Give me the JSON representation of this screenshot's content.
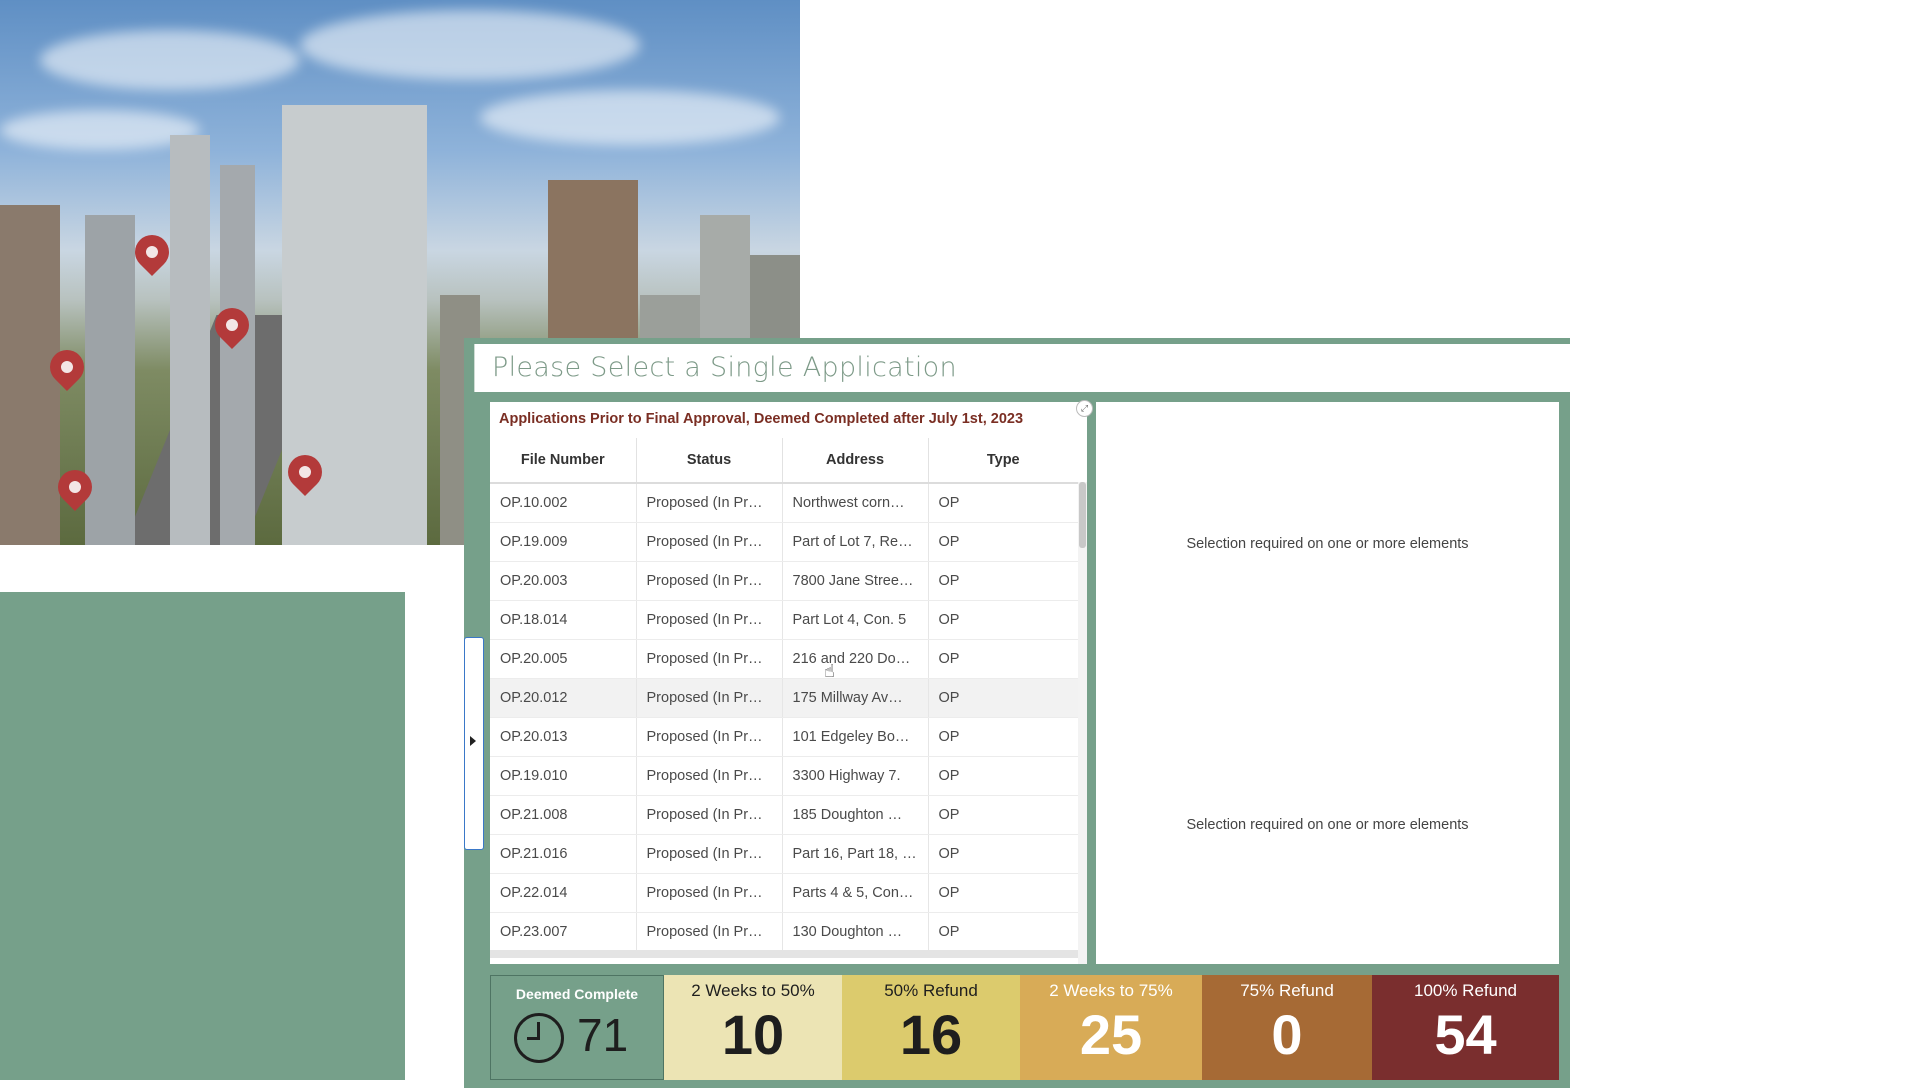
{
  "header": {
    "title": "Please Select a Single Application"
  },
  "table": {
    "title": "Applications Prior to Final Approval, Deemed Completed after July 1st, 2023",
    "columns": [
      "File Number",
      "Status",
      "Address",
      "Type"
    ],
    "rows": [
      {
        "file": "OP.10.002",
        "status": "Proposed (In Pr…",
        "address": "Northwest corn…",
        "type": "OP"
      },
      {
        "file": "OP.19.009",
        "status": "Proposed (In Pr…",
        "address": "Part of Lot 7, Re…",
        "type": "OP"
      },
      {
        "file": "OP.20.003",
        "status": "Proposed (In Pr…",
        "address": "7800 Jane Stree…",
        "type": "OP"
      },
      {
        "file": "OP.18.014",
        "status": "Proposed (In Pr…",
        "address": "Part Lot 4, Con. 5",
        "type": "OP"
      },
      {
        "file": "OP.20.005",
        "status": "Proposed (In Pr…",
        "address": "216 and 220 Do…",
        "type": "OP"
      },
      {
        "file": "OP.20.012",
        "status": "Proposed (In Pr…",
        "address": "175 Millway Av…",
        "type": "OP"
      },
      {
        "file": "OP.20.013",
        "status": "Proposed (In Pr…",
        "address": "101 Edgeley Bo…",
        "type": "OP"
      },
      {
        "file": "OP.19.010",
        "status": "Proposed (In Pr…",
        "address": "3300 Highway 7.",
        "type": "OP"
      },
      {
        "file": "OP.21.008",
        "status": "Proposed (In Pr…",
        "address": "185 Doughton …",
        "type": "OP"
      },
      {
        "file": "OP.21.016",
        "status": "Proposed (In Pr…",
        "address": "Part 16, Part 18, …",
        "type": "OP"
      },
      {
        "file": "OP.22.014",
        "status": "Proposed (In Pr…",
        "address": "Parts 4 & 5, Con…",
        "type": "OP"
      },
      {
        "file": "OP.23.007",
        "status": "Proposed (In Pr…",
        "address": "130 Doughton …",
        "type": "OP"
      }
    ],
    "highlighted_row": 5
  },
  "right_panel": {
    "message_top": "Selection required on one or more elements",
    "message_bottom": "Selection required on one or more elements"
  },
  "stats": {
    "deemed": {
      "label": "Deemed Complete",
      "value": "71"
    },
    "two_weeks_50": {
      "label": "2 Weeks to 50%",
      "value": "10"
    },
    "refund_50": {
      "label": "50% Refund",
      "value": "16"
    },
    "two_weeks_75": {
      "label": "2 Weeks to 75%",
      "value": "25"
    },
    "refund_75": {
      "label": "75% Refund",
      "value": "0"
    },
    "refund_100": {
      "label": "100% Refund",
      "value": "54"
    }
  },
  "colors": {
    "frame_green": "#76a08a",
    "title_accent": "#7a2e23",
    "stat_2w50": "#ece4b4",
    "stat_50": "#dccb6d",
    "stat_2w75": "#d8ab57",
    "stat_75": "#a66a35",
    "stat_100": "#7a2e2e"
  },
  "icons": [
    "map-pin-icon",
    "clock-icon",
    "expand-icon",
    "collapse-arrow-icon",
    "hand-cursor-icon"
  ]
}
